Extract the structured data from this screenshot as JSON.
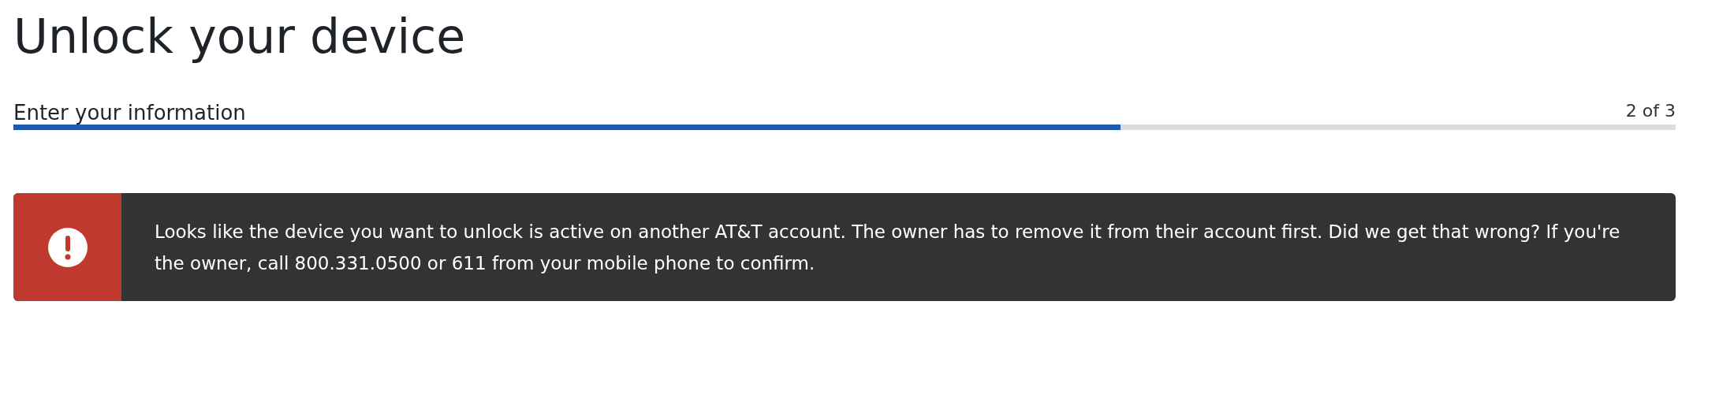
{
  "title": "Unlock your device",
  "progress": {
    "label": "Enter your information",
    "step": "2 of 3",
    "level": 0.666
  },
  "alert": {
    "kind": "error",
    "message": "Looks like the device you want to unlock is active on another AT&T account. The owner has to remove it from their account first. Did we get that wrong? If you're the owner, call 800.331.0500 or 611 from your mobile phone to confirm."
  }
}
